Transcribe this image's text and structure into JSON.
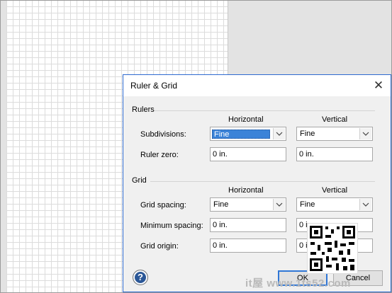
{
  "dialog": {
    "title": "Ruler & Grid",
    "close_icon": "close-icon",
    "rulers": {
      "section_label": "Rulers",
      "horizontal_header": "Horizontal",
      "vertical_header": "Vertical",
      "subdivisions_label": "Subdivisions:",
      "subdivisions_h": "Fine",
      "subdivisions_v": "Fine",
      "ruler_zero_label": "Ruler zero:",
      "ruler_zero_h": "0 in.",
      "ruler_zero_v": "0 in."
    },
    "grid": {
      "section_label": "Grid",
      "horizontal_header": "Horizontal",
      "vertical_header": "Vertical",
      "spacing_label": "Grid spacing:",
      "spacing_h": "Fine",
      "spacing_v": "Fine",
      "min_spacing_label": "Minimum spacing:",
      "min_spacing_h": "0 in.",
      "min_spacing_v": "0 in.",
      "origin_label": "Grid origin:",
      "origin_h": "0 in.",
      "origin_v": "0 in."
    },
    "help_label": "?",
    "ok_label": "OK",
    "cancel_label": "Cancel"
  },
  "watermark": "it屋 www.1ts52.com"
}
